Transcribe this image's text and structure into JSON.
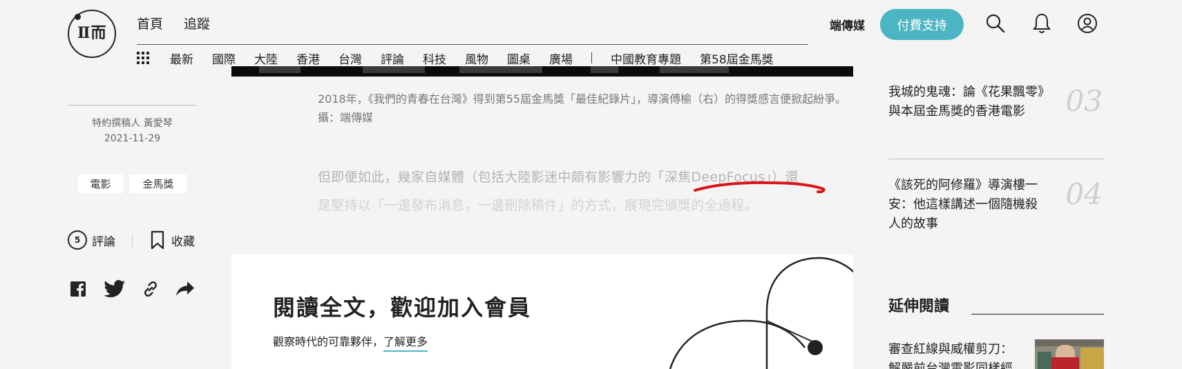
{
  "header": {
    "logo_text": "Ⅱ而",
    "top_links": [
      "首頁",
      "追蹤"
    ],
    "categories": [
      "最新",
      "國際",
      "大陸",
      "香港",
      "台灣",
      "評論",
      "科技",
      "風物",
      "圖桌",
      "廣場"
    ],
    "topic_links": [
      "中國教育專題",
      "第58屆金馬獎"
    ],
    "brand_name": "端傳媒",
    "pay_button": "付費支持"
  },
  "article": {
    "author": "特約撰稿人 黃愛琴",
    "date": "2021-11-29",
    "tags": [
      "電影",
      "金馬獎"
    ],
    "comment_count": "5",
    "comment_label": "評論",
    "save_label": "收藏",
    "caption": "2018年，《我們的青春在台灣》得到第55屆金馬獎「最佳紀錄片」，導演傅榆（右）的得獎感言便掀起紛爭。攝：端傳媒",
    "body_before": "但即便如此，幾家自媒體（包括大陸影迷中頗有影響力的",
    "body_highlight": "「深焦DeepFocus」",
    "body_after": "）還",
    "body_line2": "是堅持以「一邊發布消息，一邊刪除稿件」的方式，展現完頒獎的全過程。"
  },
  "paywall": {
    "title": "閱讀全文，歡迎加入會員",
    "subtitle": "觀察時代的可靠夥伴，",
    "link": "了解更多"
  },
  "sidebar": {
    "ranked": [
      {
        "title": "我城的鬼魂：論《花果飄零》與本屆金馬獎的香港電影",
        "num": "03"
      },
      {
        "title": "《該死的阿修羅》導演樓一安：他這樣講述一個隨機殺人的故事",
        "num": "04"
      }
    ],
    "extended_title": "延伸閱讀",
    "extended_item": "審查紅線與威權剪刀：解嚴前台灣電影同樣經"
  },
  "colors": {
    "accent": "#4cb5c3",
    "highlight_scribble": "#d9171a"
  },
  "icons": [
    "grid-icon",
    "search-icon",
    "bell-icon",
    "user-icon",
    "bookmark-icon",
    "facebook-icon",
    "twitter-icon",
    "link-icon",
    "share-icon"
  ]
}
